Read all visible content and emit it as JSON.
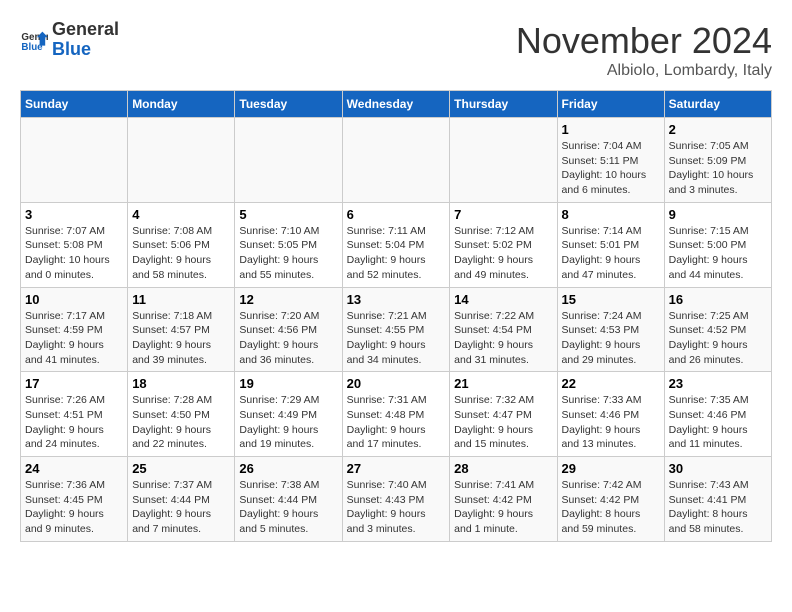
{
  "header": {
    "logo_line1": "General",
    "logo_line2": "Blue",
    "month": "November 2024",
    "location": "Albiolo, Lombardy, Italy"
  },
  "weekdays": [
    "Sunday",
    "Monday",
    "Tuesday",
    "Wednesday",
    "Thursday",
    "Friday",
    "Saturday"
  ],
  "weeks": [
    [
      {
        "day": "",
        "info": ""
      },
      {
        "day": "",
        "info": ""
      },
      {
        "day": "",
        "info": ""
      },
      {
        "day": "",
        "info": ""
      },
      {
        "day": "",
        "info": ""
      },
      {
        "day": "1",
        "info": "Sunrise: 7:04 AM\nSunset: 5:11 PM\nDaylight: 10 hours and 6 minutes."
      },
      {
        "day": "2",
        "info": "Sunrise: 7:05 AM\nSunset: 5:09 PM\nDaylight: 10 hours and 3 minutes."
      }
    ],
    [
      {
        "day": "3",
        "info": "Sunrise: 7:07 AM\nSunset: 5:08 PM\nDaylight: 10 hours and 0 minutes."
      },
      {
        "day": "4",
        "info": "Sunrise: 7:08 AM\nSunset: 5:06 PM\nDaylight: 9 hours and 58 minutes."
      },
      {
        "day": "5",
        "info": "Sunrise: 7:10 AM\nSunset: 5:05 PM\nDaylight: 9 hours and 55 minutes."
      },
      {
        "day": "6",
        "info": "Sunrise: 7:11 AM\nSunset: 5:04 PM\nDaylight: 9 hours and 52 minutes."
      },
      {
        "day": "7",
        "info": "Sunrise: 7:12 AM\nSunset: 5:02 PM\nDaylight: 9 hours and 49 minutes."
      },
      {
        "day": "8",
        "info": "Sunrise: 7:14 AM\nSunset: 5:01 PM\nDaylight: 9 hours and 47 minutes."
      },
      {
        "day": "9",
        "info": "Sunrise: 7:15 AM\nSunset: 5:00 PM\nDaylight: 9 hours and 44 minutes."
      }
    ],
    [
      {
        "day": "10",
        "info": "Sunrise: 7:17 AM\nSunset: 4:59 PM\nDaylight: 9 hours and 41 minutes."
      },
      {
        "day": "11",
        "info": "Sunrise: 7:18 AM\nSunset: 4:57 PM\nDaylight: 9 hours and 39 minutes."
      },
      {
        "day": "12",
        "info": "Sunrise: 7:20 AM\nSunset: 4:56 PM\nDaylight: 9 hours and 36 minutes."
      },
      {
        "day": "13",
        "info": "Sunrise: 7:21 AM\nSunset: 4:55 PM\nDaylight: 9 hours and 34 minutes."
      },
      {
        "day": "14",
        "info": "Sunrise: 7:22 AM\nSunset: 4:54 PM\nDaylight: 9 hours and 31 minutes."
      },
      {
        "day": "15",
        "info": "Sunrise: 7:24 AM\nSunset: 4:53 PM\nDaylight: 9 hours and 29 minutes."
      },
      {
        "day": "16",
        "info": "Sunrise: 7:25 AM\nSunset: 4:52 PM\nDaylight: 9 hours and 26 minutes."
      }
    ],
    [
      {
        "day": "17",
        "info": "Sunrise: 7:26 AM\nSunset: 4:51 PM\nDaylight: 9 hours and 24 minutes."
      },
      {
        "day": "18",
        "info": "Sunrise: 7:28 AM\nSunset: 4:50 PM\nDaylight: 9 hours and 22 minutes."
      },
      {
        "day": "19",
        "info": "Sunrise: 7:29 AM\nSunset: 4:49 PM\nDaylight: 9 hours and 19 minutes."
      },
      {
        "day": "20",
        "info": "Sunrise: 7:31 AM\nSunset: 4:48 PM\nDaylight: 9 hours and 17 minutes."
      },
      {
        "day": "21",
        "info": "Sunrise: 7:32 AM\nSunset: 4:47 PM\nDaylight: 9 hours and 15 minutes."
      },
      {
        "day": "22",
        "info": "Sunrise: 7:33 AM\nSunset: 4:46 PM\nDaylight: 9 hours and 13 minutes."
      },
      {
        "day": "23",
        "info": "Sunrise: 7:35 AM\nSunset: 4:46 PM\nDaylight: 9 hours and 11 minutes."
      }
    ],
    [
      {
        "day": "24",
        "info": "Sunrise: 7:36 AM\nSunset: 4:45 PM\nDaylight: 9 hours and 9 minutes."
      },
      {
        "day": "25",
        "info": "Sunrise: 7:37 AM\nSunset: 4:44 PM\nDaylight: 9 hours and 7 minutes."
      },
      {
        "day": "26",
        "info": "Sunrise: 7:38 AM\nSunset: 4:44 PM\nDaylight: 9 hours and 5 minutes."
      },
      {
        "day": "27",
        "info": "Sunrise: 7:40 AM\nSunset: 4:43 PM\nDaylight: 9 hours and 3 minutes."
      },
      {
        "day": "28",
        "info": "Sunrise: 7:41 AM\nSunset: 4:42 PM\nDaylight: 9 hours and 1 minute."
      },
      {
        "day": "29",
        "info": "Sunrise: 7:42 AM\nSunset: 4:42 PM\nDaylight: 8 hours and 59 minutes."
      },
      {
        "day": "30",
        "info": "Sunrise: 7:43 AM\nSunset: 4:41 PM\nDaylight: 8 hours and 58 minutes."
      }
    ]
  ]
}
